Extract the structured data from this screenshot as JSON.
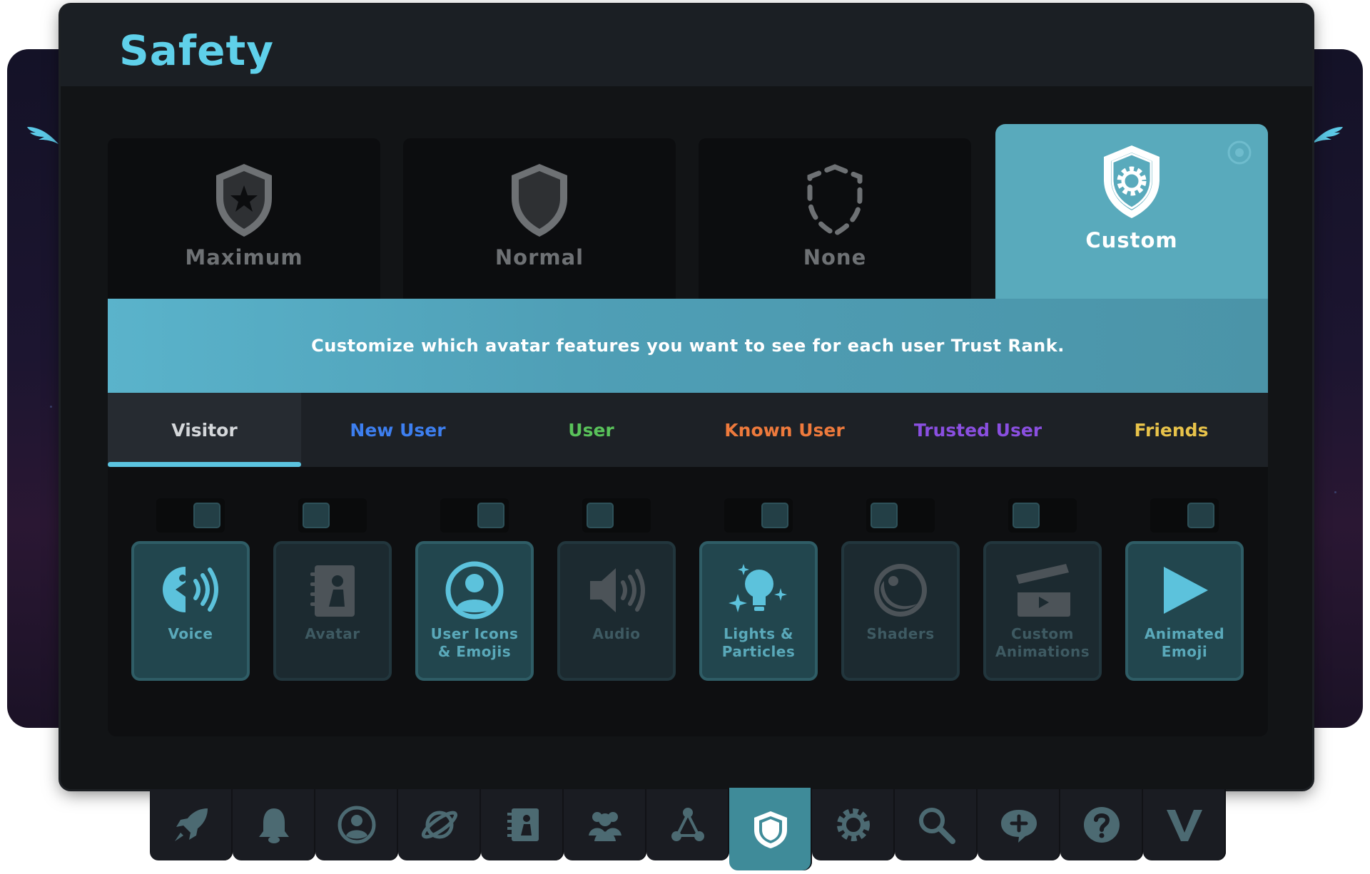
{
  "window": {
    "title": "Safety"
  },
  "presets": [
    {
      "label": "Maximum",
      "icon": "shield-star-icon",
      "selected": false
    },
    {
      "label": "Normal",
      "icon": "shield-icon",
      "selected": false
    },
    {
      "label": "None",
      "icon": "shield-dashed-icon",
      "selected": false
    },
    {
      "label": "Custom",
      "icon": "shield-gear-icon",
      "selected": true
    }
  ],
  "banner": {
    "text": "Customize which avatar features you want to see for each user Trust Rank."
  },
  "tabs": [
    {
      "label": "Visitor",
      "color": "#d4d7da",
      "selected": true
    },
    {
      "label": "New User",
      "color": "#3d7ff0"
    },
    {
      "label": "User",
      "color": "#59c25a"
    },
    {
      "label": "Known User",
      "color": "#ee7a3c"
    },
    {
      "label": "Trusted User",
      "color": "#8a4fe0"
    },
    {
      "label": "Friends",
      "color": "#e8c34a"
    }
  ],
  "features": [
    {
      "label": "Voice",
      "icon": "voice-icon",
      "enabled": true
    },
    {
      "label": "Avatar",
      "icon": "avatar-book-icon",
      "enabled": false
    },
    {
      "label": "User Icons\n& Emojis",
      "icon": "user-circle-icon",
      "enabled": true
    },
    {
      "label": "Audio",
      "icon": "speaker-icon",
      "enabled": false
    },
    {
      "label": "Lights &\nParticles",
      "icon": "lightbulb-sparkle-icon",
      "enabled": true
    },
    {
      "label": "Shaders",
      "icon": "shader-sphere-icon",
      "enabled": false
    },
    {
      "label": "Custom\nAnimations",
      "icon": "clapperboard-icon",
      "enabled": false
    },
    {
      "label": "Animated\nEmoji",
      "icon": "play-icon",
      "enabled": true
    }
  ],
  "dock": [
    {
      "name": "launch",
      "icon": "rocket-icon"
    },
    {
      "name": "notifications",
      "icon": "bell-icon"
    },
    {
      "name": "profile",
      "icon": "user-circle-icon"
    },
    {
      "name": "worlds",
      "icon": "planet-icon"
    },
    {
      "name": "avatars",
      "icon": "avatar-book-icon"
    },
    {
      "name": "social",
      "icon": "people-icon"
    },
    {
      "name": "groups",
      "icon": "network-icon"
    },
    {
      "name": "safety",
      "icon": "shield-icon",
      "active": true
    },
    {
      "name": "settings",
      "icon": "gear-icon"
    },
    {
      "name": "search",
      "icon": "search-icon"
    },
    {
      "name": "feedback",
      "icon": "chat-plus-icon"
    },
    {
      "name": "help",
      "icon": "help-icon"
    },
    {
      "name": "vrchat-plus",
      "icon": "v-logo-icon"
    }
  ]
}
